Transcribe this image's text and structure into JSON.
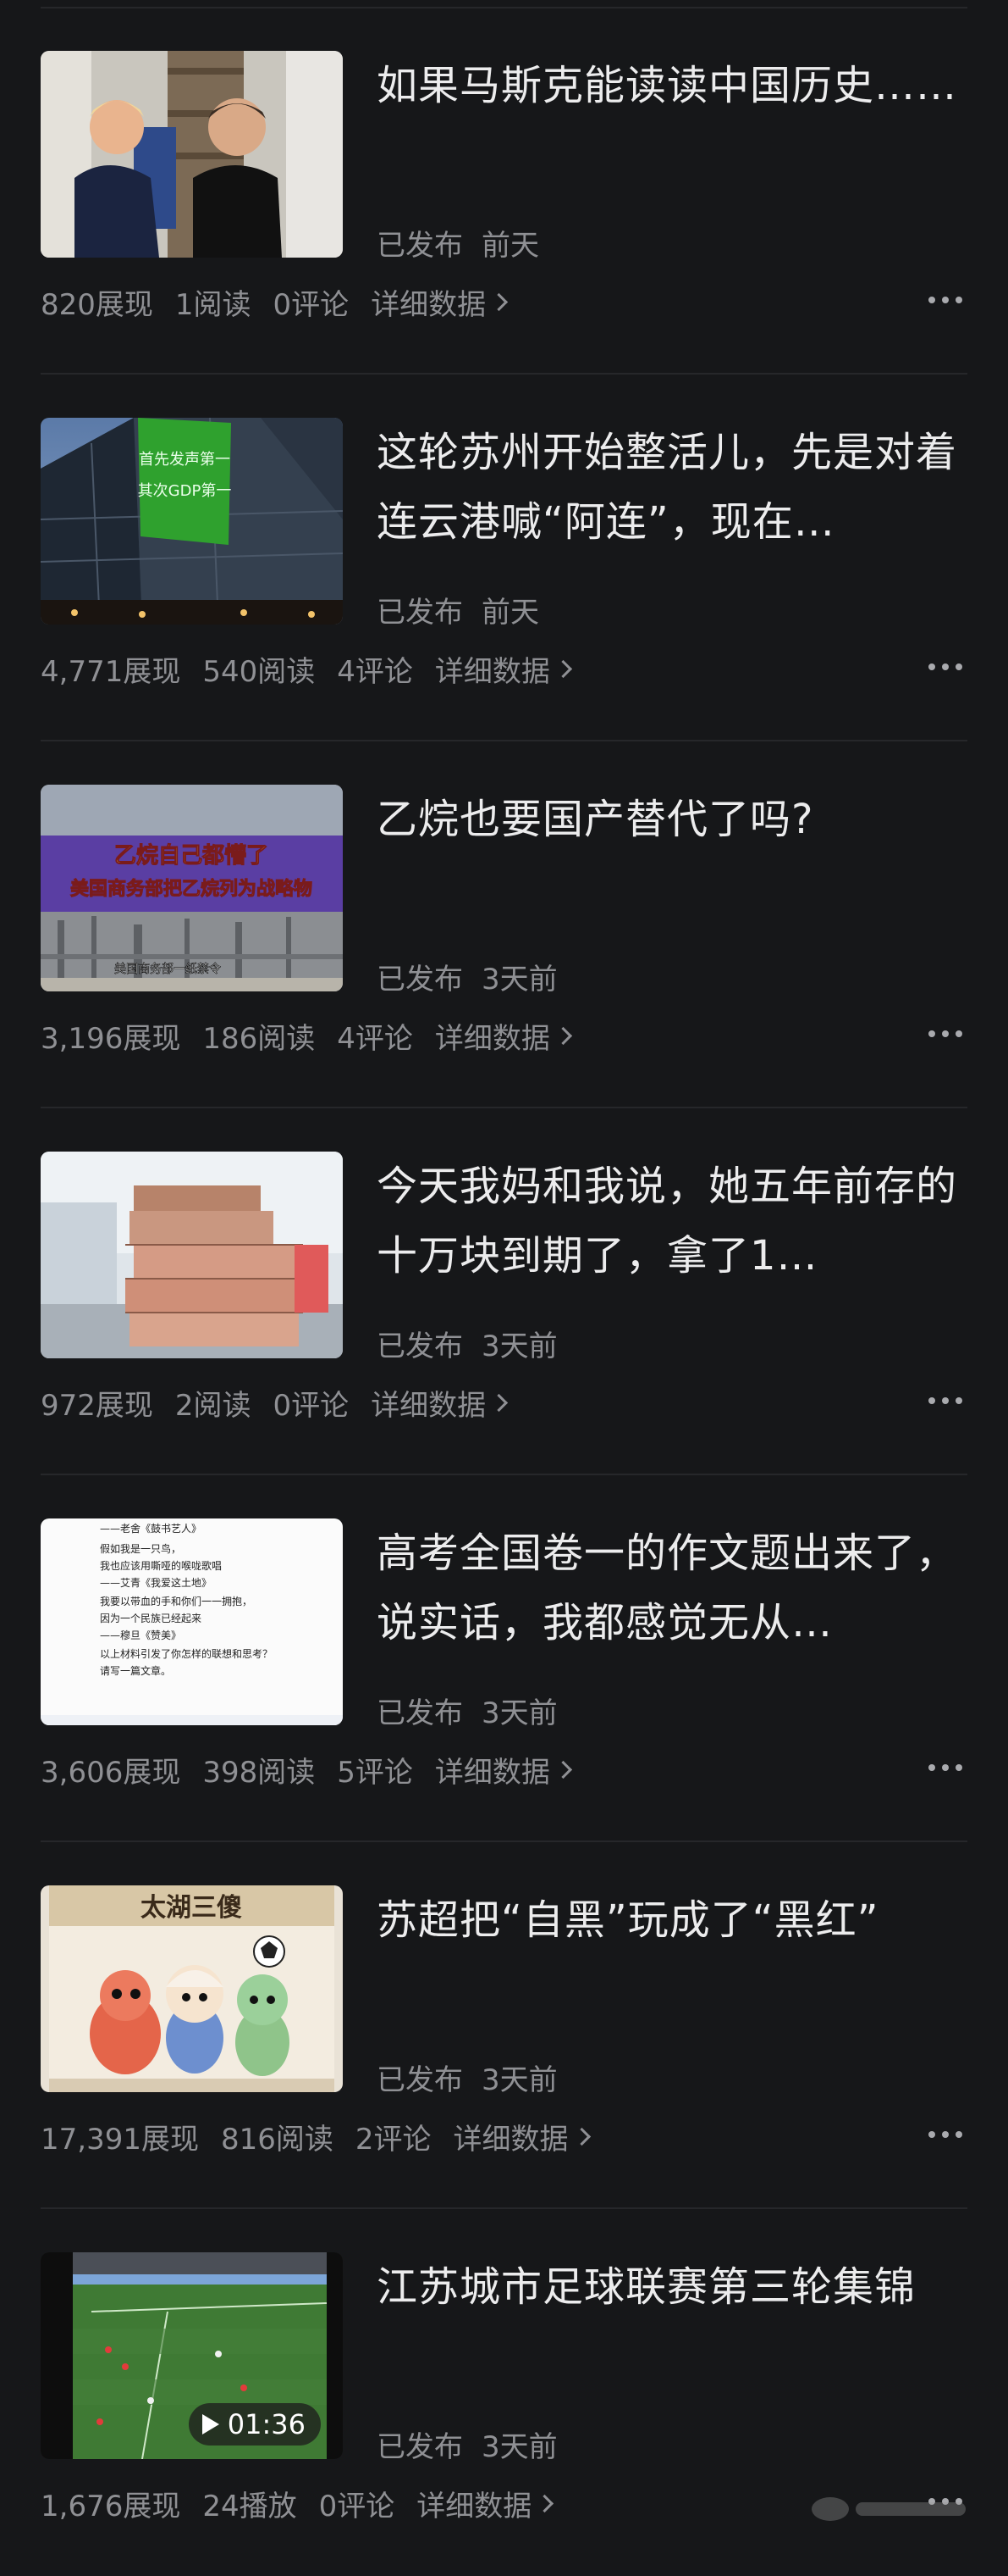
{
  "feed": {
    "items": [
      {
        "title": "如果马斯克能读读中国历史……",
        "status": "已发布",
        "time": "前天",
        "views": "820展现",
        "reads": "1阅读",
        "comments": "0评论",
        "detail": "详细数据",
        "thumb": "portrait-photo"
      },
      {
        "title": "这轮苏州开始整活儿，先是对着连云港喊“阿连”，现在…",
        "status": "已发布",
        "time": "前天",
        "views": "4,771展现",
        "reads": "540阅读",
        "comments": "4评论",
        "detail": "详细数据",
        "thumb": "building-screen",
        "thumb_text": [
          "首先发声第一",
          "其次GDP第一"
        ]
      },
      {
        "title": "乙烷也要国产替代了吗?",
        "status": "已发布",
        "time": "3天前",
        "views": "3,196展现",
        "reads": "186阅读",
        "comments": "4评论",
        "detail": "详细数据",
        "thumb": "industrial-banner",
        "thumb_text": [
          "乙烷自己都懵了",
          "美国商务部把乙烷列为战略物",
          "美国商务部一纸禁令"
        ]
      },
      {
        "title": "今天我妈和我说，她五年前存的十万块到期了，拿了1…",
        "status": "已发布",
        "time": "3天前",
        "views": "972展现",
        "reads": "2阅读",
        "comments": "0评论",
        "detail": "详细数据",
        "thumb": "money-stack"
      },
      {
        "title": "高考全国卷一的作文题出来了，说实话，我都感觉无从…",
        "status": "已发布",
        "time": "3天前",
        "views": "3,606展现",
        "reads": "398阅读",
        "comments": "5评论",
        "detail": "详细数据",
        "thumb": "essay-text",
        "thumb_text": [
          "——老舍《鼓书艺人》",
          "假如我是一只鸟，",
          "我也应该用嘶哑的喉咙歌唱",
          "——艾青《我爱这土地》",
          "我要以带血的手和你们一一拥抱，",
          "因为一个民族已经起来",
          "——穆旦《赞美》",
          "以上材料引发了你怎样的联想和思考？",
          "请写一篇文章。"
        ]
      },
      {
        "title": "苏超把“自黑”玩成了“黑红”",
        "status": "已发布",
        "time": "3天前",
        "views": "17,391展现",
        "reads": "816阅读",
        "comments": "2评论",
        "detail": "详细数据",
        "thumb": "figurines",
        "thumb_text": [
          "太湖三傻"
        ]
      },
      {
        "title": "江苏城市足球联赛第三轮集锦",
        "status": "已发布",
        "time": "3天前",
        "views": "1,676展现",
        "reads": "24播放",
        "comments": "0评论",
        "detail": "详细数据",
        "thumb": "football-video",
        "duration": "01:36"
      }
    ]
  },
  "colors": {
    "background": "#161719",
    "title": "#ececed",
    "meta": "#8f9094",
    "divider": "#26272a"
  }
}
